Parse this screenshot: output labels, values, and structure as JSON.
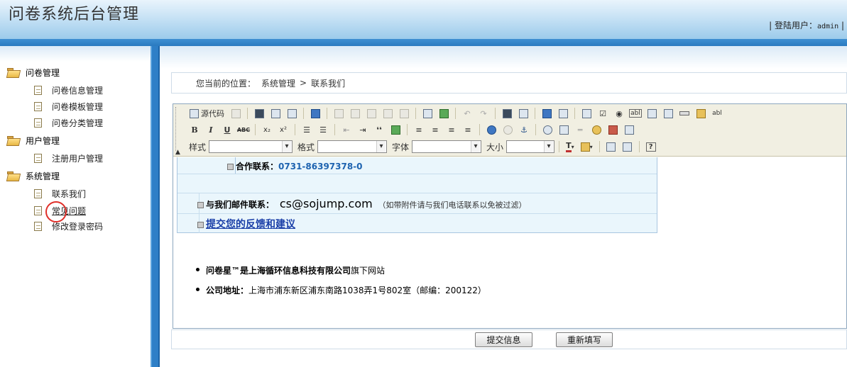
{
  "header": {
    "title": "问卷系统后台管理",
    "user_prefix": "| 登陆用户：",
    "username": "admin",
    "user_suffix": "|"
  },
  "sidebar": {
    "groups": [
      {
        "label": "问卷管理",
        "items": [
          "问卷信息管理",
          "问卷模板管理",
          "问卷分类管理"
        ]
      },
      {
        "label": "用户管理",
        "items": [
          "注册用户管理"
        ]
      },
      {
        "label": "系统管理",
        "items": [
          "联系我们",
          "常见问题",
          "修改登录密码"
        ]
      }
    ]
  },
  "breadcrumb": {
    "prefix": "您当前的位置：",
    "level1": "系统管理",
    "separator": ">",
    "level2": "联系我们"
  },
  "toolbar": {
    "source_label": "源代码",
    "style_label": "样式",
    "format_label": "格式",
    "font_label": "字体",
    "size_label": "大小",
    "bold": "B",
    "italic": "I",
    "underline": "U",
    "strike": "ABC",
    "subscript": "x₂",
    "superscript": "x²",
    "quote": "❛❛",
    "textfield": "abl",
    "textcolor": "T"
  },
  "content": {
    "coop_label": "合作联系：",
    "coop_phone": "0731-86397378-0",
    "email_label": "与我们邮件联系：",
    "email": "cs@sojump.com",
    "email_note": "（如带附件请与我们电话联系以免被过滤）",
    "feedback_link": "提交您的反馈和建议",
    "company_line_bold": "问卷星™是上海循环信息科技有限公司",
    "company_line_rest": "旗下网站",
    "address_label": "公司地址：",
    "address_value": "上海市浦东新区浦东南路1038弄1号802室（邮编：200122）"
  },
  "buttons": {
    "submit": "提交信息",
    "reset": "重新填写"
  }
}
